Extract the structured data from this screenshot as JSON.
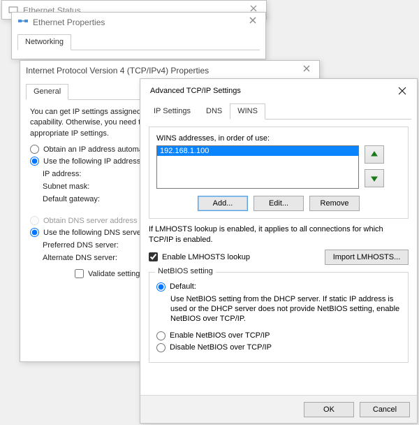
{
  "win_status": {
    "title": "Ethernet Status"
  },
  "win_props": {
    "title": "Ethernet Properties",
    "tab_networking": "Networking"
  },
  "win_ipv4": {
    "title": "Internet Protocol Version 4 (TCP/IPv4) Properties",
    "tab_general": "General",
    "intro": "You can get IP settings assigned automatically if your network supports this capability. Otherwise, you need to ask your network administrator for the appropriate IP settings.",
    "radio_obtain_ip": "Obtain an IP address automatically",
    "radio_use_ip": "Use the following IP address:",
    "lbl_ip": "IP address:",
    "lbl_subnet": "Subnet mask:",
    "lbl_gateway": "Default gateway:",
    "radio_obtain_dns": "Obtain DNS server address automatically",
    "radio_use_dns": "Use the following DNS server addresses:",
    "lbl_pref_dns": "Preferred DNS server:",
    "lbl_alt_dns": "Alternate DNS server:",
    "chk_validate": "Validate settings upon exit"
  },
  "win_adv": {
    "title": "Advanced TCP/IP Settings",
    "tabs": {
      "ip": "IP Settings",
      "dns": "DNS",
      "wins": "WINS"
    },
    "wins_label": "WINS addresses, in order of use:",
    "wins_entry": "192.168.1.100",
    "btn_add": "Add...",
    "btn_edit": "Edit...",
    "btn_remove": "Remove",
    "lmhosts_info": "If LMHOSTS lookup is enabled, it applies to all connections for which TCP/IP is enabled.",
    "chk_lmhosts": "Enable LMHOSTS lookup",
    "btn_import_lmhosts": "Import LMHOSTS...",
    "netbios_legend": "NetBIOS setting",
    "nb_default": "Default:",
    "nb_default_desc": "Use NetBIOS setting from the DHCP server. If static IP address is used or the DHCP server does not provide NetBIOS setting, enable NetBIOS over TCP/IP.",
    "nb_enable": "Enable NetBIOS over TCP/IP",
    "nb_disable": "Disable NetBIOS over TCP/IP",
    "btn_ok": "OK",
    "btn_cancel": "Cancel"
  }
}
